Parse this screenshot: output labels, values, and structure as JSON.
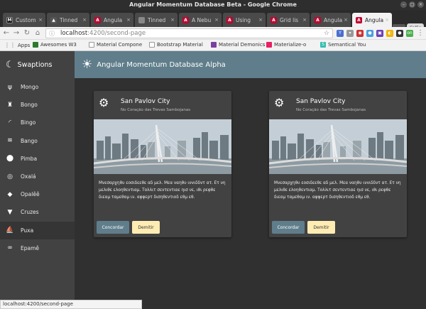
{
  "window": {
    "title": "Angular Momentum Database Beta - Google Chrome"
  },
  "tabs": [
    {
      "label": "Custom",
      "icon": "m-icon"
    },
    {
      "label": "Tinned",
      "icon": "hat-icon"
    },
    {
      "label": "Angula",
      "icon": "angular-icon"
    },
    {
      "label": "Tinned",
      "icon": "image-icon"
    },
    {
      "label": "A Nebu",
      "icon": "angular-icon"
    },
    {
      "label": "Using",
      "icon": "angular-icon"
    },
    {
      "label": "Grid lis",
      "icon": "angular-icon"
    },
    {
      "label": "Angula",
      "icon": "angular-icon"
    },
    {
      "label": "Angula",
      "icon": "angular-icon"
    }
  ],
  "profile": {
    "label": "Callie"
  },
  "address": {
    "host": "localhost",
    "path": ":4200/second-page"
  },
  "bookmarks": [
    {
      "label": "Apps"
    },
    {
      "label": "Awesomes W3"
    },
    {
      "label": "Material Compone"
    },
    {
      "label": "Bootstrap Material"
    },
    {
      "label": "Material Demonics"
    },
    {
      "label": "Materialize-o"
    },
    {
      "label": "Semantical You"
    }
  ],
  "sidebar": {
    "brand": "Swaptions",
    "items": [
      {
        "label": "Mongo",
        "icon": "utensils-icon"
      },
      {
        "label": "Bongo",
        "icon": "walking-icon"
      },
      {
        "label": "Bingo",
        "icon": "wifi-icon"
      },
      {
        "label": "Bango",
        "icon": "waves-icon"
      },
      {
        "label": "Pimba",
        "icon": "location-pin-icon"
      },
      {
        "label": "Oxalá",
        "icon": "target-icon"
      },
      {
        "label": "Opalêê",
        "icon": "box-icon"
      },
      {
        "label": "Cruzes",
        "icon": "cocktail-icon"
      },
      {
        "label": "Puxa",
        "icon": "rowing-icon"
      },
      {
        "label": "Epamê",
        "icon": "infinity-icon"
      }
    ]
  },
  "header": {
    "title": "Angular Momentum Database Alpha",
    "icon": "sun-icon"
  },
  "cards": [
    {
      "title": "San Pavlov City",
      "subtitle": "No Coração das Trevas Sambojanas",
      "text": "Μνεσαρχηθυ εοσιδεεθε αδ μελ. Μεα ναηθυ ινvιδδντ ατ. Ετ νη μελιθε ελοηθεντιαμ. Τολλιτ σεντεντιαε ηισ νε, ιθι ρεφθε διεαμ ταμεθαμ ιν. αφφερτ δισηθεντιοδ εθμ εθ.",
      "agree_label": "Concordar",
      "dismiss_label": "Demitir"
    },
    {
      "title": "San Pavlov City",
      "subtitle": "No Coração das Trevas Sambojanas",
      "text": "Μνεσαρχηθυ εοσιδεεθε αδ μελ. Μεα ναηθυ ινvιδδντ ατ. Ετ νη μελιθε ελοηθεντιαμ. Τολλιτ σεντεντιαε ηισ νε, ιθι ρεφθε διεαμ ταμεθαμ ιν. αφφερτ δισηθεντιοδ εθμ εθ.",
      "agree_label": "Concordar",
      "dismiss_label": "Demitir"
    }
  ],
  "status": {
    "url": "localhost:4200/second-page"
  },
  "colors": {
    "header": "#607d8b",
    "sidebar": "#424242",
    "background": "#303030",
    "agree": "#607d8b",
    "dismiss": "#ffecb3"
  }
}
